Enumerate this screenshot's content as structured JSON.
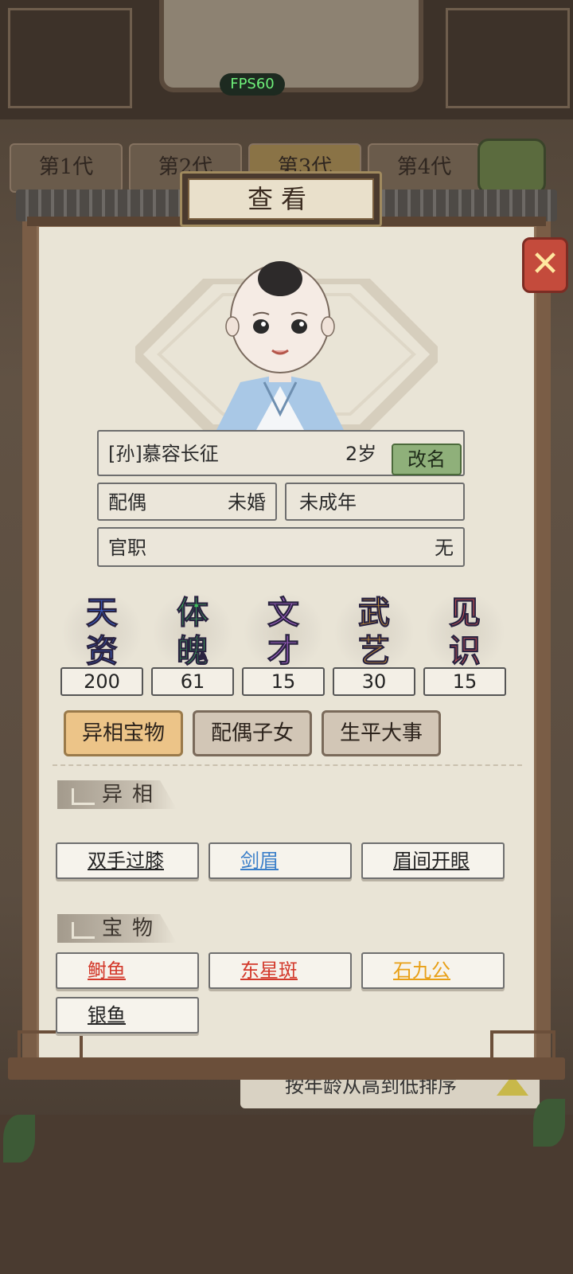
{
  "hud": {
    "fps": "FPS60"
  },
  "generation_tabs": [
    "第1代",
    "第2代",
    "第3代",
    "第4代"
  ],
  "sort": {
    "label": "按年龄从高到低排序"
  },
  "panel": {
    "title": "查看"
  },
  "character": {
    "name": "[孙]慕容长征",
    "age": "2岁",
    "rename_label": "改名",
    "spouse_label": "配偶",
    "spouse_value": "未婚",
    "status": "未成年",
    "office_label": "官职",
    "office_value": "无"
  },
  "stats": [
    {
      "name": "天资",
      "value": "200",
      "color": "#3a64d8"
    },
    {
      "name": "体魄",
      "value": "61",
      "color": "#3fbf5c"
    },
    {
      "name": "文才",
      "value": "15",
      "color": "#b06ad8"
    },
    {
      "name": "武艺",
      "value": "30",
      "color": "#e0a030"
    },
    {
      "name": "见识",
      "value": "15",
      "color": "#e05858"
    }
  ],
  "tabs": {
    "items": [
      "异相宝物",
      "配偶子女",
      "生平大事"
    ],
    "active": "异相宝物"
  },
  "sections": {
    "traits_title": "异相",
    "treasures_title": "宝物"
  },
  "traits": [
    {
      "label": "双手过膝",
      "color": "#222222"
    },
    {
      "label": "剑眉",
      "color": "#3b7fc9"
    },
    {
      "label": "眉间开眼",
      "color": "#222222"
    }
  ],
  "treasures": [
    {
      "label": "鲥鱼",
      "color": "#d33a2c"
    },
    {
      "label": "东星斑",
      "color": "#d33a2c"
    },
    {
      "label": "石九公",
      "color": "#e8a018"
    },
    {
      "label": "银鱼",
      "color": "#222222"
    }
  ]
}
